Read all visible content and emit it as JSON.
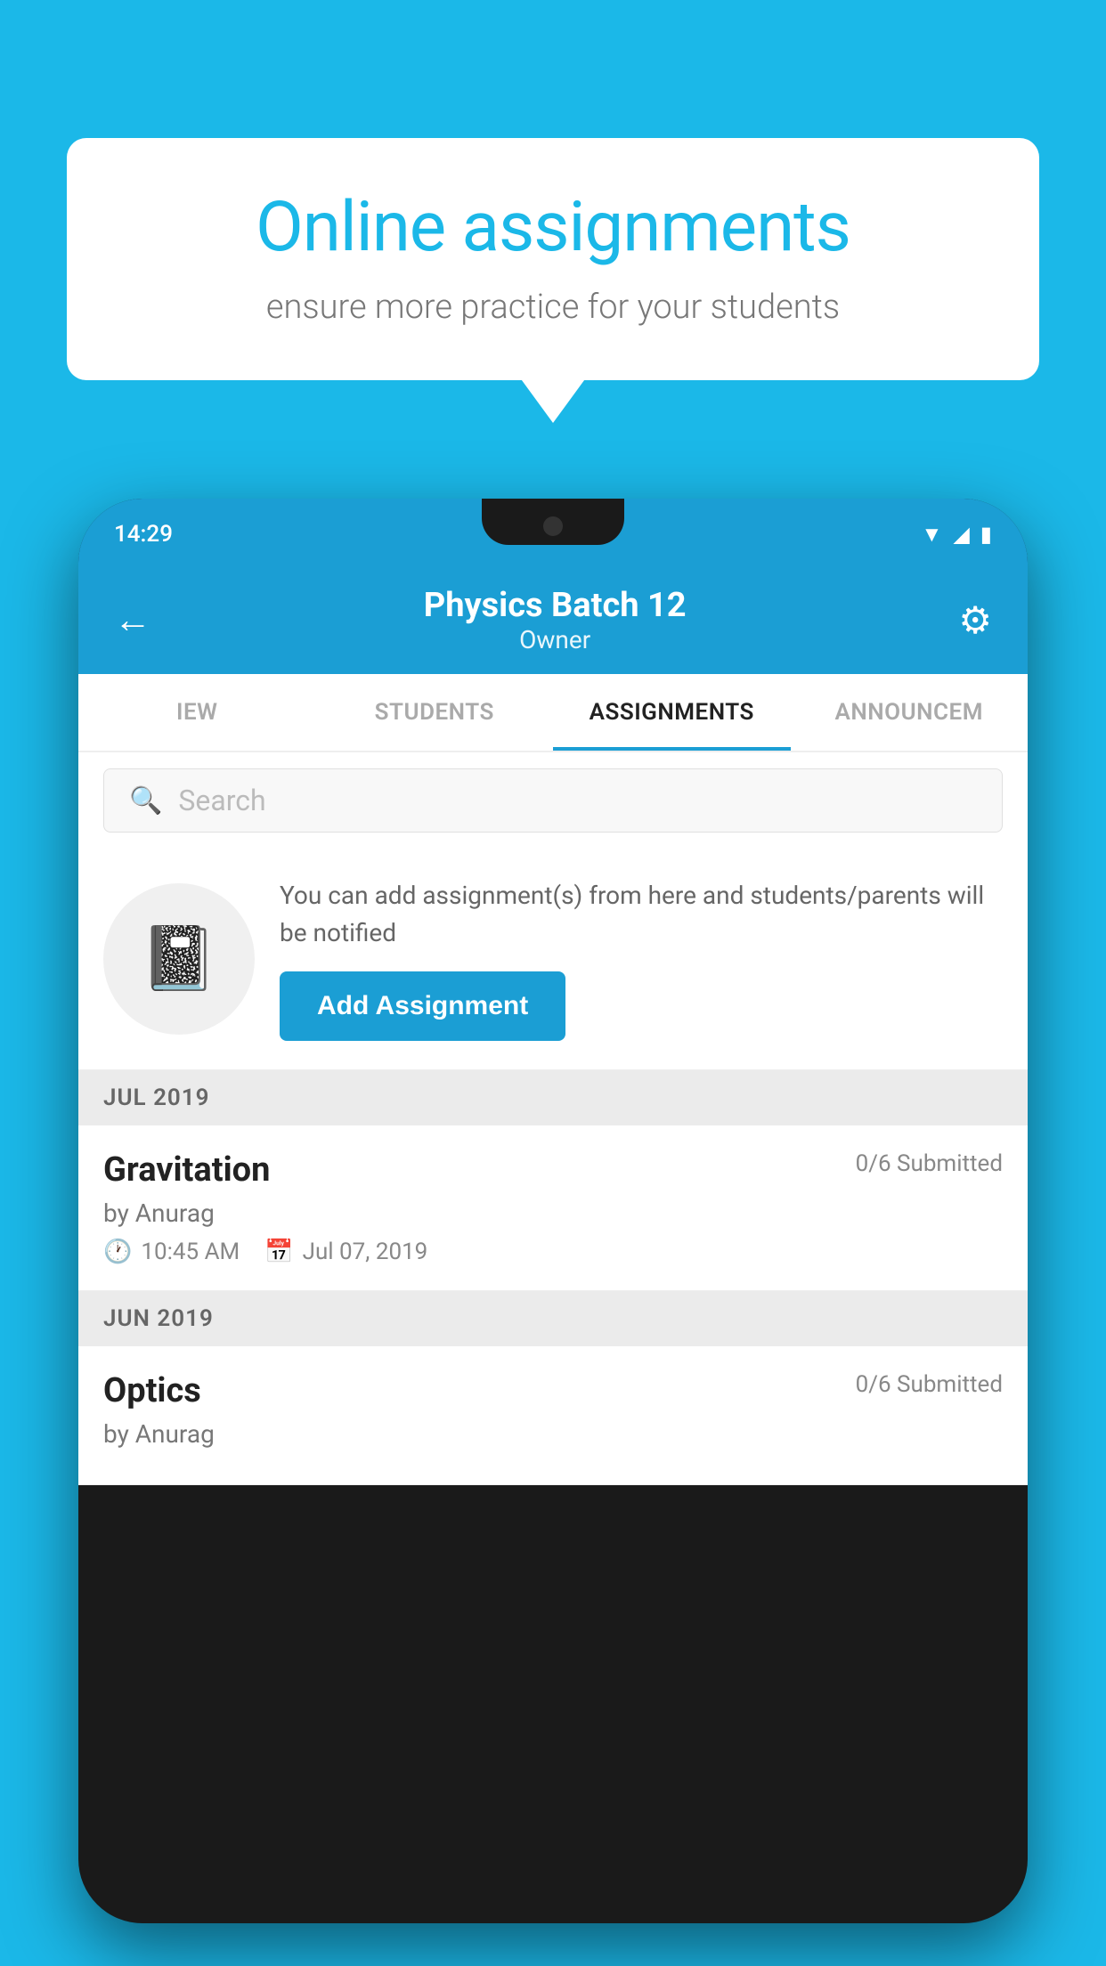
{
  "background": {
    "color": "#1BB8E8"
  },
  "speech_bubble": {
    "title": "Online assignments",
    "subtitle": "ensure more practice for your students"
  },
  "phone": {
    "status_bar": {
      "time": "14:29",
      "icons": [
        "wifi",
        "signal",
        "battery"
      ]
    },
    "header": {
      "title": "Physics Batch 12",
      "subtitle": "Owner",
      "back_label": "←",
      "settings_label": "⚙"
    },
    "tabs": [
      {
        "label": "IEW",
        "active": false
      },
      {
        "label": "STUDENTS",
        "active": false
      },
      {
        "label": "ASSIGNMENTS",
        "active": true
      },
      {
        "label": "ANNOUNCEM",
        "active": false
      }
    ],
    "search": {
      "placeholder": "Search"
    },
    "promo": {
      "description": "You can add assignment(s) from here and students/parents will be notified",
      "button_label": "Add Assignment"
    },
    "sections": [
      {
        "header": "JUL 2019",
        "assignments": [
          {
            "title": "Gravitation",
            "submitted": "0/6 Submitted",
            "by": "by Anurag",
            "time": "10:45 AM",
            "date": "Jul 07, 2019"
          }
        ]
      },
      {
        "header": "JUN 2019",
        "assignments": [
          {
            "title": "Optics",
            "submitted": "0/6 Submitted",
            "by": "by Anurag",
            "time": "",
            "date": ""
          }
        ]
      }
    ]
  }
}
